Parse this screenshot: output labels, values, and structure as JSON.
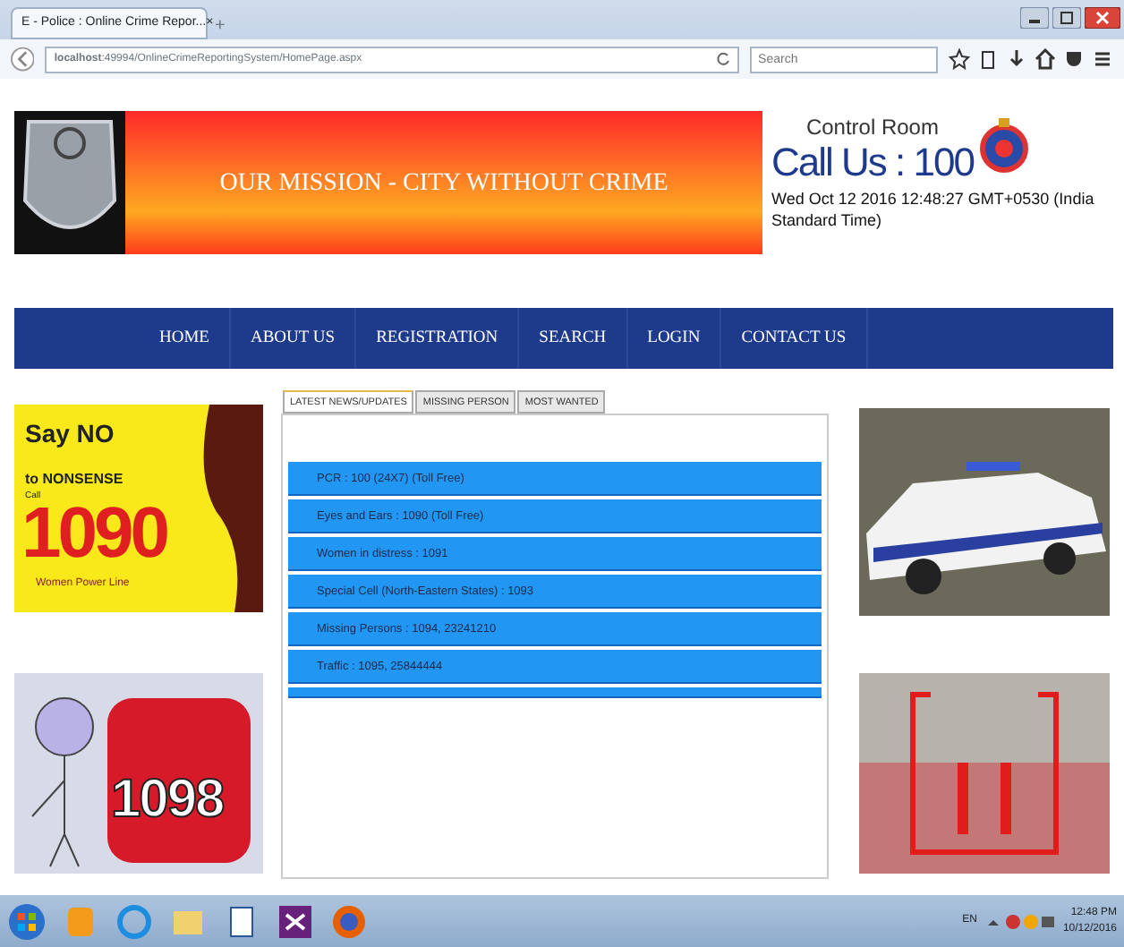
{
  "browser": {
    "tab_title": "E - Police : Online Crime Repor...",
    "tab_close": "×",
    "new_tab": "+",
    "url_host": "localhost",
    "url_path": ":49994/OnlineCrimeReportingSystem/HomePage.aspx",
    "search_placeholder": "Search"
  },
  "header": {
    "mission": "OUR MISSION - CITY WITHOUT CRIME",
    "control_room": "Control Room",
    "call_us": "Call Us : 100",
    "datetime": "Wed Oct 12 2016 12:48:27 GMT+0530 (India Standard Time)"
  },
  "nav": [
    "HOME",
    "ABOUT US",
    "REGISTRATION",
    "SEARCH",
    "LOGIN",
    "CONTACT US"
  ],
  "tabs": [
    {
      "label": "LATEST NEWS/UPDATES",
      "selected": true
    },
    {
      "label": "MISSING PERSON",
      "selected": false
    },
    {
      "label": "MOST WANTED",
      "selected": false
    }
  ],
  "news": [
    "PCR : 100 (24X7) (Toll Free)",
    "Eyes and Ears : 1090 (Toll Free)",
    "Women in distress : 1091",
    "Special Cell (North-Eastern States) : 1093",
    "Missing Persons : 1094, 23241210",
    "Traffic : 1095, 25844444"
  ],
  "left_ads": [
    {
      "kind": "women",
      "lines": [
        "Say NO",
        "to NONSENSE",
        "Call",
        "1090",
        "Women Power Line"
      ]
    },
    {
      "kind": "child",
      "lines": [
        "1098"
      ]
    }
  ],
  "taskbar": {
    "language": "EN",
    "time": "12:48 PM",
    "date": "10/12/2016"
  }
}
